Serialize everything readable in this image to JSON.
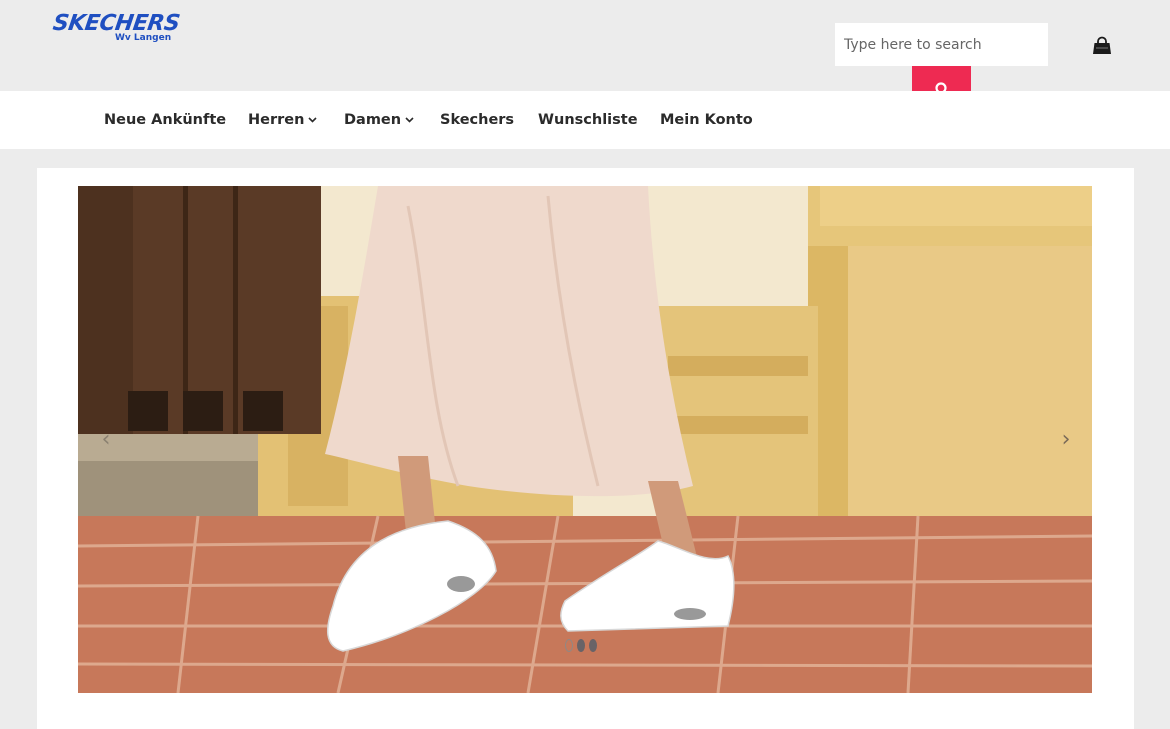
{
  "brand": {
    "name": "SKECHERS",
    "sub": "Wv Langen"
  },
  "search": {
    "placeholder": "Type here to search",
    "value": ""
  },
  "nav": {
    "items": [
      {
        "label": "Neue Ankünfte",
        "dropdown": false
      },
      {
        "label": "Herren",
        "dropdown": true
      },
      {
        "label": "Damen",
        "dropdown": true
      },
      {
        "label": "Skechers",
        "dropdown": false
      },
      {
        "label": "Wunschliste",
        "dropdown": false
      },
      {
        "label": "Mein Konto",
        "dropdown": false
      }
    ]
  },
  "slider": {
    "prev_glyph": "‹",
    "next_glyph": "›",
    "slide_count": 3,
    "active_index": 0
  },
  "icons": {
    "search_button": "search-icon",
    "cart": "shopping-bag-icon"
  },
  "colors": {
    "brand_blue": "#1f4fc1",
    "accent_red": "#ee2a52",
    "page_bg": "#ececec"
  }
}
